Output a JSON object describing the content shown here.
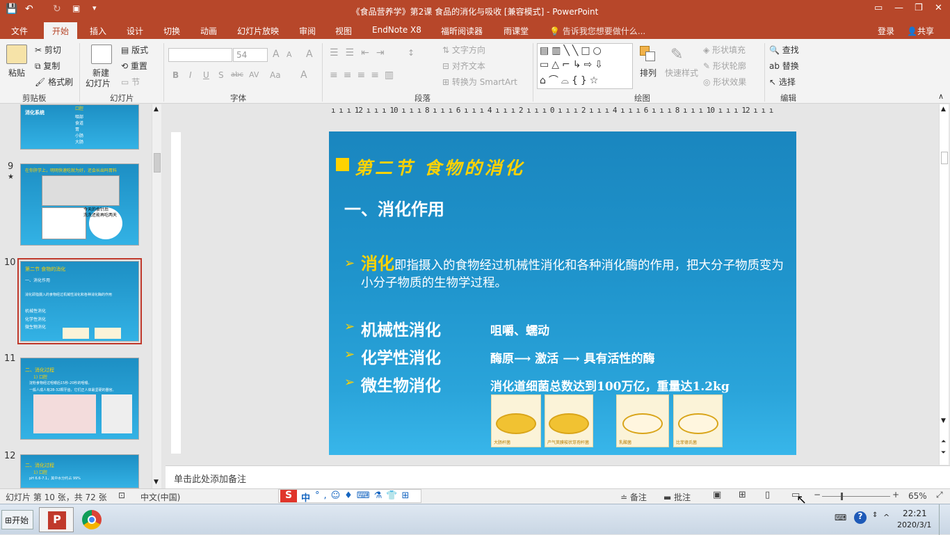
{
  "window": {
    "title": "《食品营养学》第2课 食品的消化与吸收 [兼容模式] - PowerPoint",
    "controls": [
      "▭",
      "—",
      "❐",
      "✕"
    ]
  },
  "quick_access": {
    "save": "💾",
    "undo": "↶",
    "redo": "↻",
    "customize": "▾"
  },
  "tabs": [
    "文件",
    "开始",
    "插入",
    "设计",
    "切换",
    "动画",
    "幻灯片放映",
    "审阅",
    "视图",
    "EndNote X8",
    "福昕阅读器",
    "雨课堂"
  ],
  "active_tab": "开始",
  "tell_me": "告诉我您想要做什么...",
  "login": "登录",
  "share": "共享",
  "ribbon": {
    "clipboard": {
      "paste": "粘贴",
      "cut": "剪切",
      "copy": "复制",
      "format_painter": "格式刷",
      "label": "剪贴板"
    },
    "slides": {
      "new_slide": "新建",
      "new_slide2": "幻灯片",
      "layout": "版式",
      "reset": "重置",
      "section": "节",
      "label": "幻灯片"
    },
    "font": {
      "name": "",
      "size": "54",
      "label": "字体",
      "grow": "A",
      "shrink": "A",
      "clear": "A",
      "bold": "B",
      "italic": "I",
      "underline": "U",
      "shadow": "S",
      "strike": "abc",
      "spacing": "AV",
      "case": "Aa",
      "color": "A"
    },
    "paragraph": {
      "text_direction": "文字方向",
      "align_text": "对齐文本",
      "smartart": "转换为 SmartArt",
      "label": "段落"
    },
    "drawing": {
      "arrange": "排列",
      "quick_styles": "快速样式",
      "fill": "形状填充",
      "outline": "形状轮廓",
      "effects": "形状效果",
      "label": "绘图"
    },
    "editing": {
      "find": "查找",
      "replace": "替换",
      "select": "选择",
      "label": "编辑"
    }
  },
  "ruler": {
    "horizontal": "ı ı ı 12 ı ı ı 10 ı ı ı 8 ı ı ı 6 ı ı ı 4 ı ı ı 2 ı ı ı 0 ı ı ı 2 ı ı ı 4 ı ı ı 6 ı ı ı 8 ı ı ı 10 ı ı ı 12 ı ı ı"
  },
  "thumbnails": [
    {
      "number": "",
      "title": "消化系统",
      "lines": [
        "口腔",
        "咽部",
        "食道",
        "胃",
        "小肠",
        "大肠"
      ]
    },
    {
      "number": "9",
      "star": "★",
      "title": "在你肝学上，明明快速吃就为好，还会长出吗胃料",
      "lines": [
        "今天的食针后",
        "洗洗还能再吃两天"
      ]
    },
    {
      "number": "10",
      "title": "第二节 食物的消化",
      "lines": [
        "一、消化作用",
        "消化即指摄入的食物经过机械性消化和各种消化酶的作用",
        "机械性消化",
        "化学性消化",
        "微生物消化"
      ]
    },
    {
      "number": "11",
      "title": "二、消化过程",
      "lines": [
        "1) 口腔",
        "淀粉食物经过咀嚼后15秒-20秒的咀嚼。",
        "一般人成人有28-32颗牙齿，它们正人体最坚硬的器官。"
      ]
    },
    {
      "number": "12",
      "title": "二、消化过程",
      "lines": [
        "1) 口腔",
        "pH 6.6-7.1，其中水分约占 99%"
      ]
    }
  ],
  "slide": {
    "heading": "第二节 食物的消化",
    "subheading": "一、消化作用",
    "body_keyword": "消化",
    "body_text": "即指摄入的食物经过机械性消化和各种消化酶的作用，把大分子物质变为小分子物质的生物学过程。",
    "items": [
      {
        "term": "机械性消化",
        "desc": "咀嚼、蠕动"
      },
      {
        "term": "化学性消化",
        "desc": "酶原⟶ 激活 ⟶ 具有活性的酶"
      },
      {
        "term": "微生物消化",
        "desc": "消化道细菌总数达到100万亿，重量达1.2kg"
      }
    ],
    "images": [
      "大肠杆菌",
      "产气荚膜梭状芽孢杆菌",
      "乳酸菌",
      "比菲德氏菌"
    ],
    "bullet": "➢"
  },
  "notes": {
    "placeholder": "单击此处添加备注"
  },
  "status": {
    "slide_info": "幻灯片 第 10 张，共 72 张",
    "language": "中文(中国)",
    "ime": "中",
    "notes_btn": "备注",
    "comments_btn": "批注",
    "zoom": "65%"
  },
  "taskbar": {
    "start": "开始",
    "time": "22:21",
    "date": "2020/3/1"
  },
  "colors": {
    "accent": "#b7472a",
    "slide_bg": "#1d8fc4",
    "highlight": "#ffd200"
  }
}
